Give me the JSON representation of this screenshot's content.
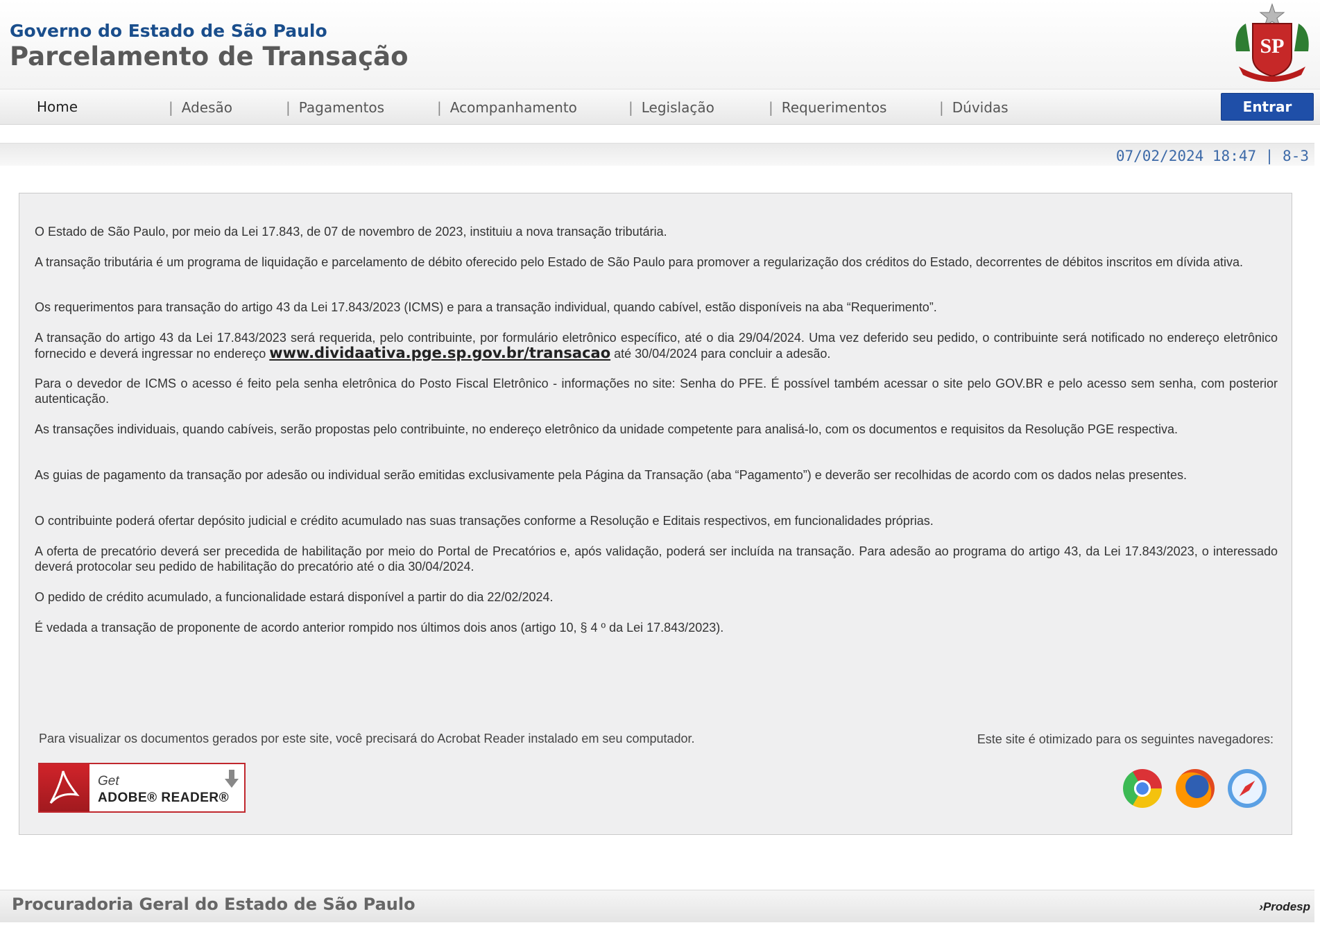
{
  "header": {
    "gov_title": "Governo do Estado de São Paulo",
    "page_title": "Parcelamento de Transação",
    "seal_label": "SP"
  },
  "nav": {
    "items": [
      "Home",
      "Adesão",
      "Pagamentos",
      "Acompanhamento",
      "Legislação",
      "Requerimentos",
      "Dúvidas"
    ],
    "login_label": "Entrar"
  },
  "status": {
    "datetime": "07/02/2024 18:47 | 8-3"
  },
  "content": {
    "p1": "O Estado de São Paulo, por meio da Lei 17.843, de 07 de novembro de 2023, instituiu a nova transação tributária.",
    "p2": "A transação tributária é um programa de liquidação e parcelamento de débito oferecido pelo Estado de São Paulo para promover a regularização dos créditos do Estado, decorrentes de débitos inscritos em dívida ativa.",
    "p3": "Os requerimentos para transação do artigo 43 da Lei 17.843/2023 (ICMS) e para a transação individual, quando cabível, estão disponíveis na aba “Requerimento”.",
    "p4_before": "A transação do artigo 43 da Lei 17.843/2023 será requerida, pelo contribuinte, por formulário eletrônico específico, até o dia 29/04/2024. Uma vez deferido seu pedido, o contribuinte será notificado no endereço eletrônico fornecido e deverá ingressar no endereço ",
    "p4_link": "www.dividaativa.pge.sp.gov.br/transacao",
    "p4_after": " até 30/04/2024 para concluir a adesão.",
    "p5": "Para o devedor de ICMS o acesso é feito pela senha eletrônica do Posto Fiscal Eletrônico - informações no site: Senha do PFE. É possível também acessar o site pelo GOV.BR e pelo acesso sem senha, com posterior autenticação.",
    "p6": "As transações individuais, quando cabíveis, serão propostas pelo contribuinte, no endereço eletrônico da unidade competente para analisá-lo, com os documentos e requisitos da Resolução PGE respectiva.",
    "p7": "As guias de pagamento da transação por adesão ou individual serão emitidas exclusivamente pela Página da Transação (aba “Pagamento”) e deverão ser recolhidas de acordo com os dados nelas presentes.",
    "p8": "O contribuinte poderá ofertar depósito judicial e crédito acumulado nas suas transações conforme a Resolução e Editais respectivos, em funcionalidades próprias.",
    "p9": "A oferta de precatório deverá ser precedida de habilitação por meio do Portal de Precatórios e, após validação, poderá ser incluída na transação. Para adesão ao programa do artigo 43, da Lei 17.843/2023, o interessado deverá protocolar seu pedido de habilitação do precatório até o dia 30/04/2024.",
    "p10": "O pedido de crédito acumulado, a funcionalidade estará disponível a partir do dia 22/02/2024.",
    "p11": "É vedada a transação de proponente de acordo anterior rompido nos últimos dois anos (artigo 10, § 4 º da Lei 17.843/2023)."
  },
  "downloads": {
    "acrobat_note": "Para visualizar os documentos gerados por este site, você precisará do Acrobat Reader instalado em seu computador.",
    "adobe_get": "Get",
    "adobe_name": "ADOBE® READER®",
    "browser_note": "Este site é otimizado para os seguintes navegadores:",
    "browsers": [
      "chrome-icon",
      "firefox-icon",
      "safari-icon"
    ]
  },
  "footer": {
    "title": "Procuradoria Geral do Estado de São Paulo",
    "logo": "Prodesp"
  }
}
